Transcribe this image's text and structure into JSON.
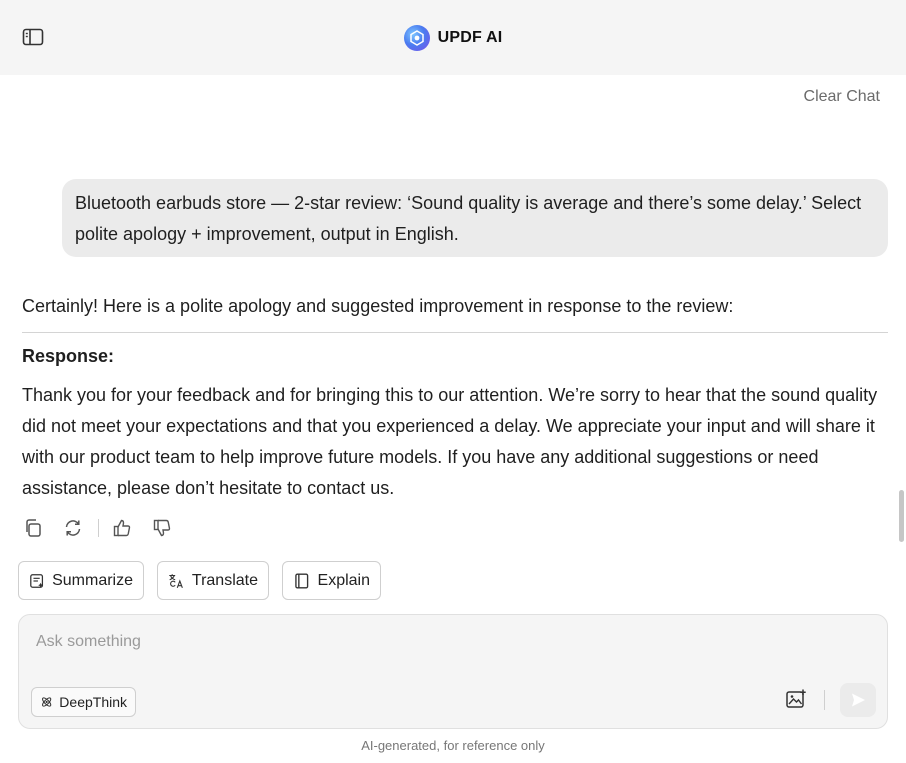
{
  "header": {
    "title": "UPDF AI",
    "sidebar_toggle_icon": "sidebar-panel-icon",
    "logo_icon": "updf-ai-logo-icon",
    "background": "#f5f5f5"
  },
  "chat": {
    "clear_label": "Clear Chat",
    "user_message": "Bluetooth earbuds store — 2-star review: ‘Sound quality is average and there’s some delay.’ Select polite apology + improvement, output in English.",
    "assistant": {
      "intro": "Certainly! Here is a polite apology and suggested improvement in response to the review:",
      "heading": "Response:",
      "body": "Thank you for your feedback and for bringing this to our attention. We’re sorry to hear that the sound quality did not meet your expectations and that you experienced a delay. We appreciate your input and will share it with our product team to help improve future models. If you have any additional suggestions or need assistance, please don’t hesitate to contact us."
    },
    "message_actions": [
      {
        "name": "copy-icon"
      },
      {
        "name": "regenerate-icon"
      },
      {
        "name": "thumbs-up-icon"
      },
      {
        "name": "thumbs-down-icon"
      }
    ]
  },
  "quick_actions": {
    "summarize": "Summarize",
    "translate": "Translate",
    "explain": "Explain"
  },
  "composer": {
    "placeholder": "Ask something",
    "value": "",
    "deepthink_label": "DeepThink",
    "upload_icon": "image-upload-icon",
    "send_icon": "send-icon"
  },
  "footer": {
    "note": "AI-generated, for reference only"
  }
}
